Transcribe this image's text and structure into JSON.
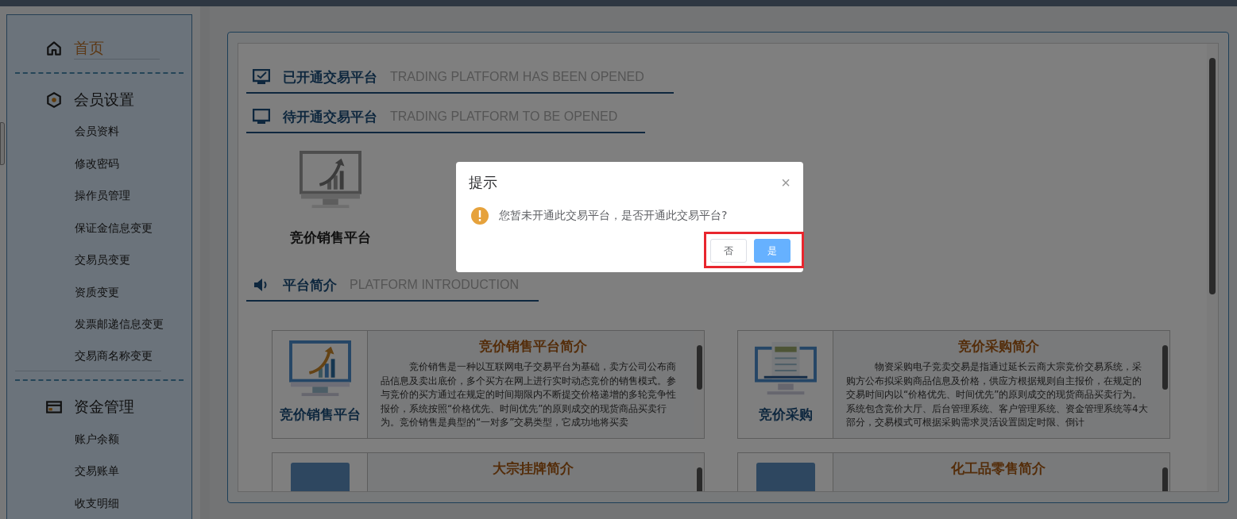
{
  "sidebar": {
    "groups": [
      {
        "title": "首页",
        "kind": "home",
        "selected": true
      },
      {
        "title": "会员设置",
        "kind": "settings",
        "selected": false,
        "items": [
          {
            "label": "会员资料",
            "selected": false
          },
          {
            "label": "修改密码",
            "selected": false
          },
          {
            "label": "操作员管理",
            "selected": false
          },
          {
            "label": "保证金信息变更",
            "selected": false
          },
          {
            "label": "交易员变更",
            "selected": false
          },
          {
            "label": "资质变更",
            "selected": false
          },
          {
            "label": "发票邮递信息变更",
            "selected": false
          },
          {
            "label": "交易商名称变更",
            "selected": false
          }
        ]
      },
      {
        "title": "资金管理",
        "kind": "funds",
        "selected": false,
        "items": [
          {
            "label": "账户余额",
            "selected": false
          },
          {
            "label": "交易账单",
            "selected": false
          },
          {
            "label": "收支明细",
            "selected": false
          }
        ]
      }
    ]
  },
  "sections": [
    {
      "kind": "opened",
      "title": "已开通交易平台",
      "subtitle": "TRADING PLATFORM HAS BEEN OPENED"
    },
    {
      "kind": "pending",
      "title": "待开通交易平台",
      "subtitle": "TRADING PLATFORM TO BE OPENED"
    }
  ],
  "platforms": [
    {
      "name": "竞价销售平台"
    }
  ],
  "intro": {
    "title": "平台简介",
    "subtitle": "PLATFORM INTRODUCTION"
  },
  "cards": [
    {
      "kind": "sales",
      "side_label": "竞价销售平台",
      "title": "竞价销售平台简介",
      "text": "竞价销售是一种以互联网电子交易平台为基础，卖方公司公布商品信息及卖出底价，多个买方在网上进行实时动态竞价的销售模式。参与竞价的买方通过在规定的时间期限内不断提交价格递增的多轮竞争性报价，系统按照“价格优先、时间优先”的原则成交的现货商品买卖行为。竞价销售是典型的“一对多”交易类型，它成功地将买卖"
    },
    {
      "kind": "purchase",
      "side_label": "竞价采购",
      "title": "竞价采购简介",
      "text": "物资采购电子竞卖交易是指通过延长云商大宗竞价交易系统，采购方公布拟采购商品信息及价格，供应方根据规则自主报价，在规定的交易时间内以“价格优先、时间优先”的原则成交的现货商品买卖行为。系统包含竞价大厅、后台管理系统、客户管理系统、资金管理系统等4大部分，交易模式可根据采购需求灵活设置固定时限、倒计"
    },
    {
      "kind": "photo",
      "title": "大宗挂牌简介"
    },
    {
      "kind": "photo",
      "title": "化工品零售简介"
    }
  ],
  "dialog": {
    "title": "提示",
    "message": "您暂未开通此交易平台，是否开通此交易平台?",
    "close": "×",
    "buttons": [
      {
        "label": "否",
        "primary": false
      },
      {
        "label": "是",
        "primary": true
      }
    ]
  }
}
